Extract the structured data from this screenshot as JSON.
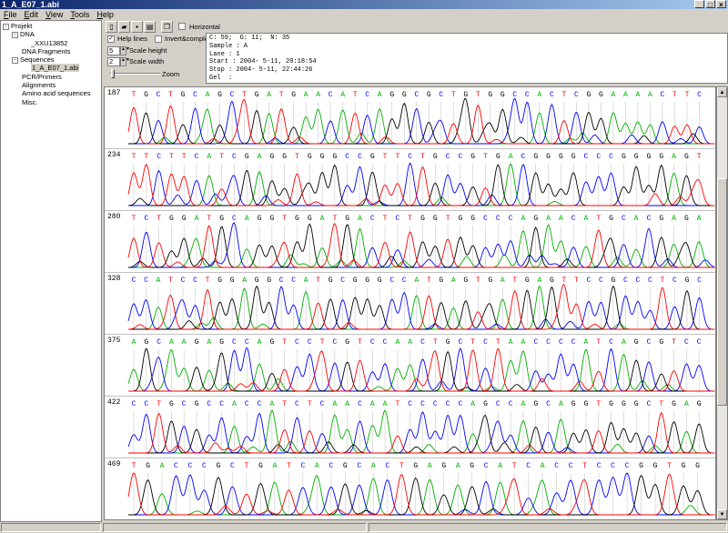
{
  "window": {
    "title": "1_A_E07_1.abi"
  },
  "menu": [
    "File",
    "Edit",
    "View",
    "Tools",
    "Help"
  ],
  "tree": [
    {
      "label": "Projekt",
      "level": 0,
      "exp": "-"
    },
    {
      "label": "DNA",
      "level": 1,
      "exp": "-"
    },
    {
      "label": "_XXU13852",
      "level": 2,
      "exp": ""
    },
    {
      "label": "DNA Fragments",
      "level": 1,
      "exp": ""
    },
    {
      "label": "Sequences",
      "level": 1,
      "exp": "-"
    },
    {
      "label": "1_A_E07_1.abi",
      "level": 2,
      "exp": "",
      "selected": true
    },
    {
      "label": "PCR/Primers",
      "level": 1,
      "exp": ""
    },
    {
      "label": "Alignments",
      "level": 1,
      "exp": ""
    },
    {
      "label": "Amino acid sequences",
      "level": 1,
      "exp": ""
    },
    {
      "label": "Misc.",
      "level": 1,
      "exp": ""
    }
  ],
  "toolbar": {
    "horizontal_label": "Horizontal"
  },
  "controls": {
    "help_lines_label": "Help lines",
    "invert_label": "Invert&complement",
    "scale_height_value": "5",
    "scale_height_label": "Scale height",
    "scale_width_value": "2",
    "scale_width_label": "Scale width",
    "zoom_label": "Zoom"
  },
  "info": {
    "line1": "C: 59;  G: 11;  N: 35",
    "line2": "Sample : A",
    "line3": "Lane : 1",
    "line4": "Start : 2004- 5-11, 20:18:54",
    "line5": "Stop : 2004- 5-11, 22:44:26",
    "line6": "Gel  :"
  },
  "colors": {
    "A": "#00b000",
    "C": "#0000ff",
    "G": "#000000",
    "T": "#ff0000"
  },
  "traces": [
    {
      "pos": "187",
      "seq": "TGCTGCAGCTGATGAACATCAGGCGCTGTGGCCACTCGGAAAACTTC"
    },
    {
      "pos": "234",
      "seq": "TTCTTCATCGAGGTGGGCCGTTCTGCCGTGACGGGGCCCGGGGAGT"
    },
    {
      "pos": "280",
      "seq": "TCTGGATGCAGGTGGATGACTCTGGTGGCCCAGAACATGCACGAGA"
    },
    {
      "pos": "328",
      "seq": "CCATCCTGGAGGCCATGCGGGCCATGAGTGATGAGTTCCGCCCTCGC"
    },
    {
      "pos": "375",
      "seq": "AGCAAGAGCCAGTCCTCGTCCAACTGCTCTAACCCCATCAGCGTCC"
    },
    {
      "pos": "422",
      "seq": "CCTGCGCCACCATCTCAACAATCCCCCAGCCAGCAGGTGGGCTGAG"
    },
    {
      "pos": "469",
      "seq": "TGACCCGCTGATCACGCACTGAGAGCATCACCTCCCGGTGG"
    }
  ]
}
